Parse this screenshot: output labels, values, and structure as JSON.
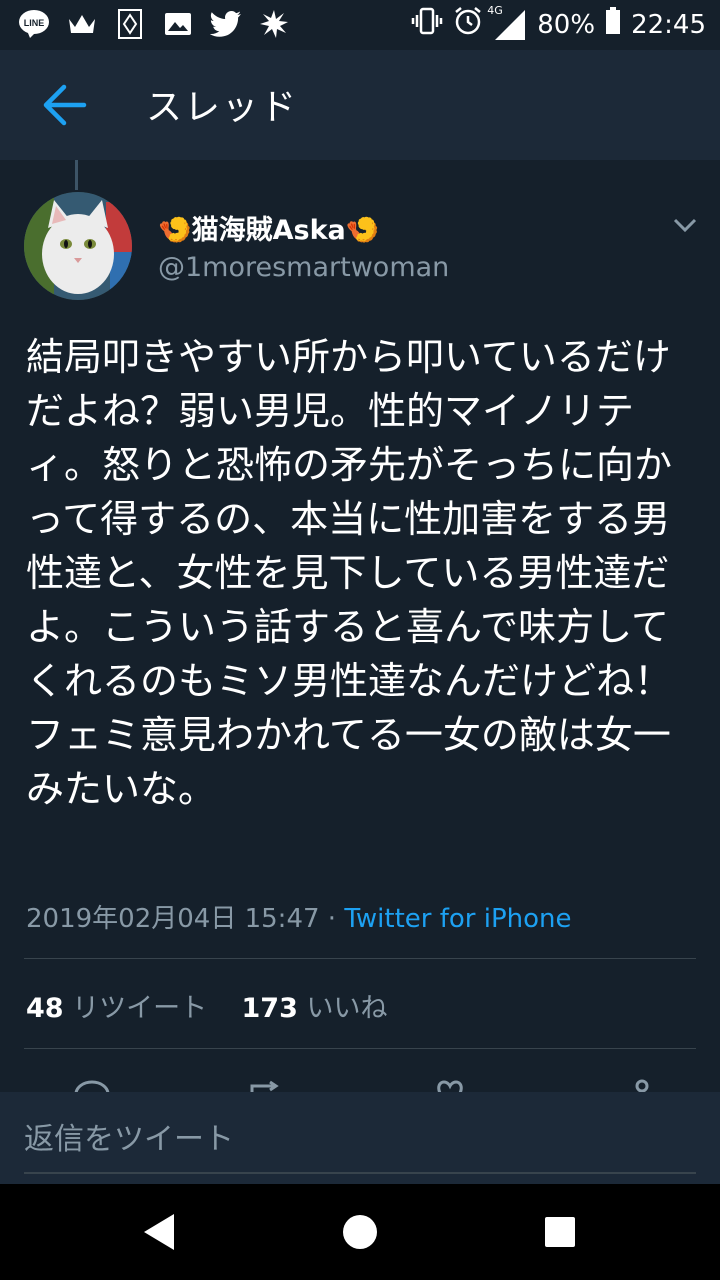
{
  "status_bar": {
    "battery_percent": "80%",
    "time": "22:45",
    "network": "4G",
    "notification_icons": [
      "line-icon",
      "crown-icon",
      "app-icon",
      "image-icon",
      "twitter-icon",
      "splash-icon"
    ]
  },
  "app_bar": {
    "title": "スレッド"
  },
  "tweet": {
    "display_name": "猫海賊Aska",
    "name_emoji": "🍤",
    "handle": "@1moresmartwoman",
    "text": "結局叩きやすい所から叩いているだけだよね？弱い男児。性的マイノリティ。怒りと恐怖の矛先がそっちに向かって得するの、本当に性加害をする男性達と、女性を見下している男性達だよ。こういう話すると喜んで味方してくれるのもミソ男性達なんだけどね！フェミ意見わかれてる一女の敵は女一みたいな。",
    "timestamp": "2019年02月04日 15:47",
    "separator": " · ",
    "source": "Twitter for iPhone",
    "retweet_count": "48",
    "retweet_label": "リツイート",
    "like_count": "173",
    "like_label": "いいね"
  },
  "reply": {
    "placeholder": "返信をツイート"
  },
  "colors": {
    "background": "#15202b",
    "appbar": "#1c2938",
    "accent": "#1da1f2",
    "secondary_text": "#8899a6",
    "divider": "#38444d"
  }
}
